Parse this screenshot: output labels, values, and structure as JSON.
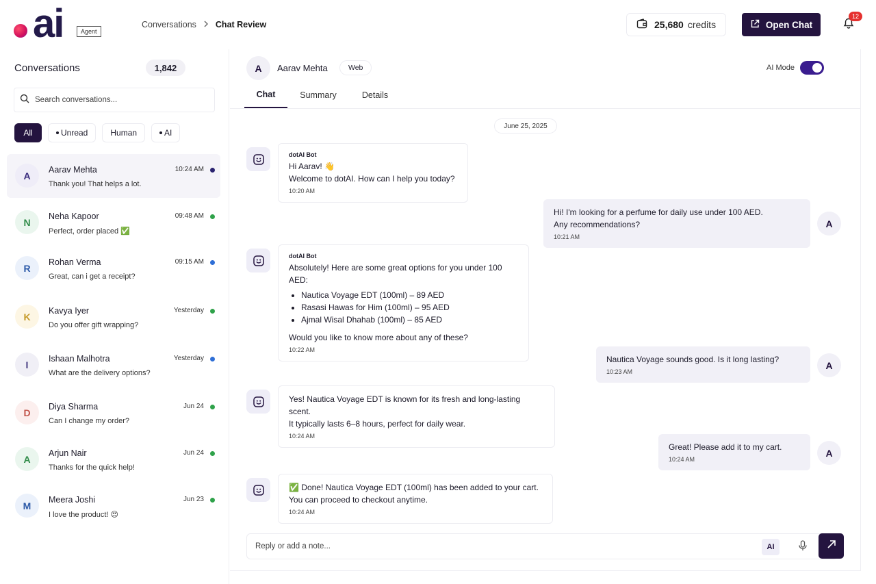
{
  "brand": {
    "logo_text": "ai",
    "badge": "Agent"
  },
  "breadcrumb": {
    "parent": "Conversations",
    "current": "Chat Review"
  },
  "credits": {
    "amount": "25,680",
    "label": "credits"
  },
  "open_chat_label": "Open Chat",
  "notifications": {
    "count": "12"
  },
  "sidebar": {
    "title": "Conversations",
    "count": "1,842",
    "search_placeholder": "Search conversations...",
    "filters": [
      "All",
      "Unread",
      "Human",
      "AI"
    ],
    "conversations": [
      {
        "initial": "A",
        "name": "Aarav Mehta",
        "message": "Thank you! That helps a lot.",
        "time": "10:24 AM",
        "dot_color": "#2b2470",
        "avatar_bg": "#efedf8",
        "avatar_fg": "#3a2c7e"
      },
      {
        "initial": "N",
        "name": "Neha Kapoor",
        "message": "Perfect, order placed ✅",
        "time": "09:48 AM",
        "dot_color": "#2fa24a",
        "avatar_bg": "#eaf6ee",
        "avatar_fg": "#2f8b48"
      },
      {
        "initial": "R",
        "name": "Rohan Verma",
        "message": "Great, can i get a receipt?",
        "time": "09:15 AM",
        "dot_color": "#2f6fd6",
        "avatar_bg": "#ebf1fb",
        "avatar_fg": "#2d5aa8"
      },
      {
        "initial": "K",
        "name": "Kavya Iyer",
        "message": "Do you offer gift wrapping?",
        "time": "Yesterday",
        "dot_color": "#2fa24a",
        "avatar_bg": "#fdf6e4",
        "avatar_fg": "#c59a2a"
      },
      {
        "initial": "I",
        "name": "Ishaan Malhotra",
        "message": "What are the delivery options?",
        "time": "Yesterday",
        "dot_color": "#2f6fd6",
        "avatar_bg": "#f0eff6",
        "avatar_fg": "#4a3f84"
      },
      {
        "initial": "D",
        "name": "Diya Sharma",
        "message": "Can I change my order?",
        "time": "Jun 24",
        "dot_color": "#2fa24a",
        "avatar_bg": "#fcefee",
        "avatar_fg": "#c2574e"
      },
      {
        "initial": "A",
        "name": "Arjun Nair",
        "message": "Thanks for the quick help!",
        "time": "Jun 24",
        "dot_color": "#2fa24a",
        "avatar_bg": "#eaf6ee",
        "avatar_fg": "#2f8b48"
      },
      {
        "initial": "M",
        "name": "Meera Joshi",
        "message": "I love the product! 😍",
        "time": "Jun 23",
        "dot_color": "#2fa24a",
        "avatar_bg": "#ebf1fb",
        "avatar_fg": "#2d5aa8"
      }
    ]
  },
  "chat": {
    "contact": {
      "initial": "A",
      "name": "Aarav Mehta",
      "channel": "Web"
    },
    "ai_mode_label": "AI Mode",
    "ai_mode_on": true,
    "tabs": [
      "Chat",
      "Summary",
      "Details"
    ],
    "date": "June 25, 2025",
    "bot_name": "dotAI Bot",
    "messages": {
      "m1": {
        "lines": [
          "Hi Aarav! 👋",
          "Welcome to dotAI. How can I help you today?"
        ],
        "time": "10:20 AM"
      },
      "m2": {
        "lines": [
          "Hi! I'm looking for a perfume for daily use under 100 AED.",
          "Any recommendations?"
        ],
        "time": "10:21 AM",
        "initial": "A"
      },
      "m3": {
        "intro": "Absolutely! Here are some great options for you under 100 AED:",
        "items": [
          "Nautica Voyage EDT (100ml) – 89 AED",
          "Rasasi Hawas for Him (100ml) – 95 AED",
          "Ajmal Wisal Dhahab (100ml) – 85 AED"
        ],
        "outro": "Would you like to know more about any of these?",
        "time": "10:22 AM"
      },
      "m4": {
        "lines": [
          "Nautica Voyage sounds good. Is it long lasting?"
        ],
        "time": "10:23 AM",
        "initial": "A"
      },
      "m5": {
        "lines": [
          "Yes! Nautica Voyage EDT is known for its fresh and long-lasting scent.",
          "It typically lasts 6–8 hours, perfect for daily wear."
        ],
        "time": "10:24 AM"
      },
      "m6": {
        "lines": [
          "Great! Please add it to my cart."
        ],
        "time": "10:24 AM",
        "initial": "A"
      },
      "m7": {
        "lines": [
          "✅ Done! Nautica Voyage EDT (100ml) has been added to your cart.",
          "You can proceed to checkout anytime."
        ],
        "time": "10:24 AM"
      }
    },
    "composer": {
      "placeholder": "Reply or add a note...",
      "ai_label": "AI"
    }
  },
  "colors": {
    "primary": "#24143f",
    "toggle": "#3a1d8f",
    "badge": "#e5312f"
  }
}
